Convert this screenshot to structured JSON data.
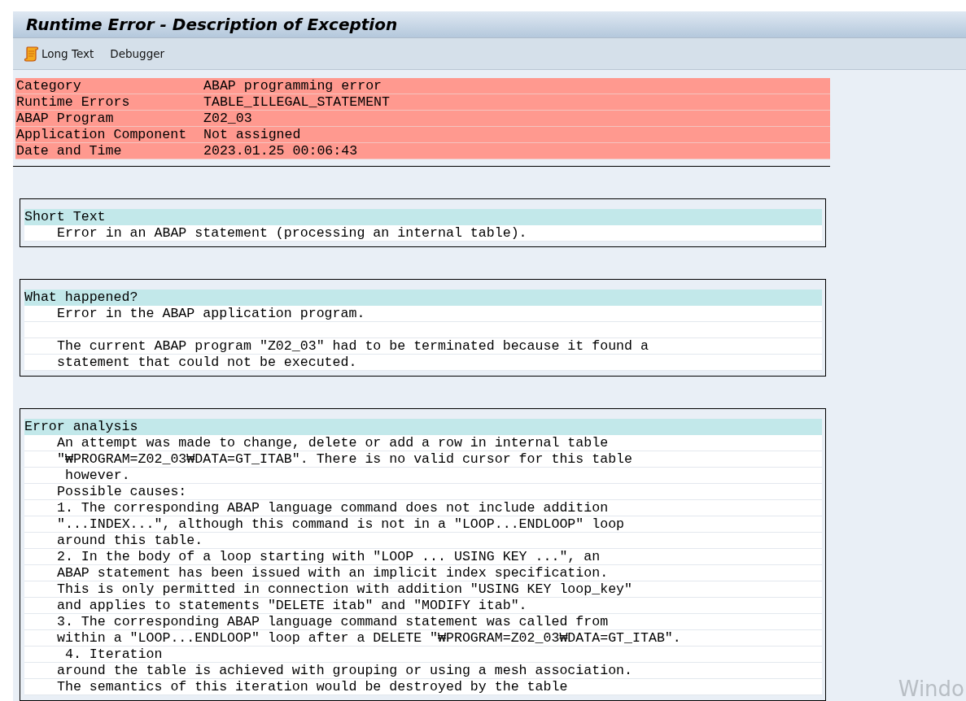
{
  "window": {
    "title": "Runtime Error - Description of Exception"
  },
  "toolbar": [
    {
      "label": "Long Text",
      "kind": "with_icon"
    },
    {
      "label": "Debugger",
      "kind": "plain"
    }
  ],
  "header_rows": [
    {
      "label": "Category",
      "value": "ABAP programming error"
    },
    {
      "label": "Runtime Errors",
      "value": "TABLE_ILLEGAL_STATEMENT"
    },
    {
      "label": "ABAP Program",
      "value": "Z02_03"
    },
    {
      "label": "Application Component",
      "value": "Not assigned"
    },
    {
      "label": "Date and Time",
      "value": "2023.01.25 00:06:43"
    }
  ],
  "sections": [
    {
      "title": "Short Text",
      "paragraphs": [
        [
          "Error in an ABAP statement (processing an internal table)."
        ]
      ]
    },
    {
      "title": "What happened?",
      "paragraphs": [
        [
          "Error in the ABAP application program."
        ],
        [
          "The current ABAP program \"Z02_03\" had to be terminated because it found a",
          "statement that could not be executed."
        ]
      ]
    },
    {
      "title": "Error analysis",
      "paragraphs": [
        [
          "An attempt was made to change, delete or add a row in internal table",
          "\"₩PROGRAM=Z02_03₩DATA=GT_ITAB\". There is no valid cursor for this table",
          " however.",
          "Possible causes:",
          "1. The corresponding ABAP language command does not include addition",
          "\"...INDEX...\", although this command is not in a \"LOOP...ENDLOOP\" loop",
          "around this table.",
          "2. In the body of a loop starting with \"LOOP ... USING KEY ...\", an",
          "ABAP statement has been issued with an implicit index specification.",
          "This is only permitted in connection with addition \"USING KEY loop_key\"",
          "and applies to statements \"DELETE itab\" and \"MODIFY itab\".",
          "3. The corresponding ABAP language command statement was called from",
          "within a \"LOOP...ENDLOOP\" loop after a DELETE \"₩PROGRAM=Z02_03₩DATA=GT_ITAB\".",
          " 4. Iteration",
          "around the table is achieved with grouping or using a mesh association.",
          "The semantics of this iteration would be destroyed by the table"
        ]
      ]
    }
  ],
  "os_overlay_text": "Windo"
}
